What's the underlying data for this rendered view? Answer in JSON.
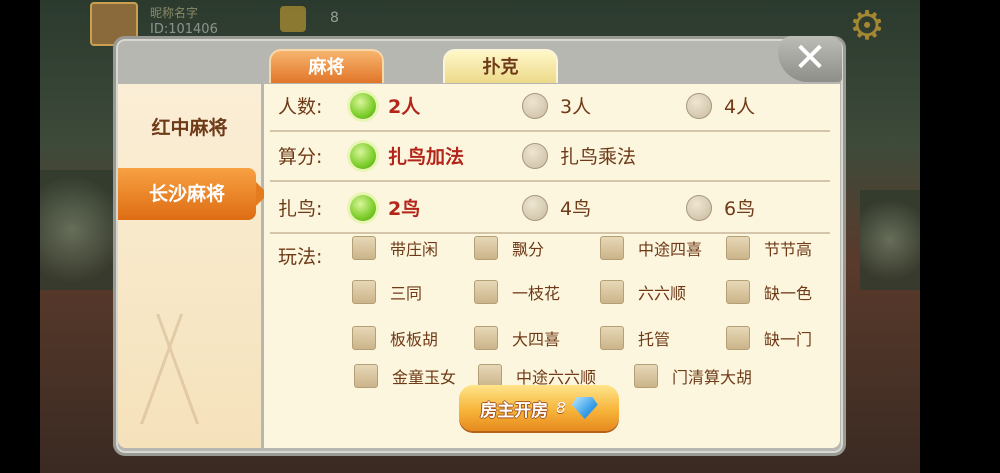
{
  "background": {
    "top_name": "昵称名字",
    "top_id": "ID:101406",
    "coin_count": "8"
  },
  "tabs": [
    {
      "label": "麻将",
      "active": true
    },
    {
      "label": "扑克",
      "active": false
    }
  ],
  "sidebar": {
    "items": [
      {
        "label": "红中麻将",
        "active": false
      },
      {
        "label": "长沙麻将",
        "active": true
      }
    ]
  },
  "settings": {
    "players": {
      "label": "人数:",
      "options": [
        {
          "label": "2人",
          "selected": true
        },
        {
          "label": "3人",
          "selected": false
        },
        {
          "label": "4人",
          "selected": false
        }
      ]
    },
    "scoring": {
      "label": "算分:",
      "options": [
        {
          "label": "扎鸟加法",
          "selected": true
        },
        {
          "label": "扎鸟乘法",
          "selected": false
        }
      ]
    },
    "birds": {
      "label": "扎鸟:",
      "options": [
        {
          "label": "2鸟",
          "selected": true
        },
        {
          "label": "4鸟",
          "selected": false
        },
        {
          "label": "6鸟",
          "selected": false
        }
      ]
    },
    "rules": {
      "label": "玩法:",
      "options": [
        "带庄闲",
        "飘分",
        "中途四喜",
        "节节高",
        "三同",
        "一枝花",
        "六六顺",
        "缺一色",
        "板板胡",
        "大四喜",
        "托管",
        "缺一门",
        "金童玉女",
        "中途六六顺",
        "门清算大胡"
      ]
    }
  },
  "create_button": {
    "label": "房主开房",
    "cost": "8"
  },
  "colors": {
    "tab_active": "#e1762a",
    "selected_text": "#b3251a",
    "label_text": "#6e3a18",
    "radio_on": "#7ccd2a"
  }
}
